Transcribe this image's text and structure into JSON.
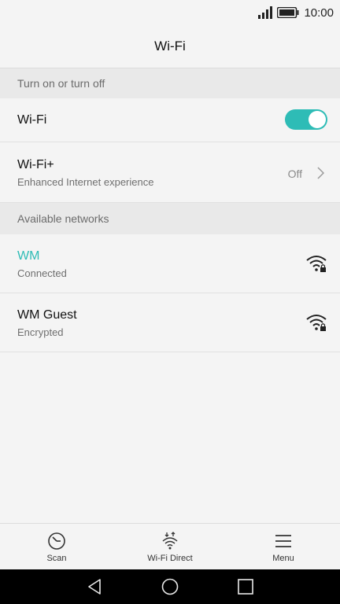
{
  "status_bar": {
    "time": "10:00"
  },
  "header": {
    "title": "Wi-Fi"
  },
  "sections": {
    "toggle_section": "Turn on or turn off",
    "networks_section": "Available networks"
  },
  "wifi_toggle": {
    "label": "Wi-Fi",
    "state": "on"
  },
  "wifi_plus": {
    "label": "Wi-Fi+",
    "subtitle": "Enhanced Internet experience",
    "value": "Off"
  },
  "networks": [
    {
      "name": "WM",
      "status": "Connected",
      "name_color": "#2ebcb6"
    },
    {
      "name": "WM Guest",
      "status": "Encrypted",
      "name_color": "#111111"
    }
  ],
  "toolbar": {
    "scan": "Scan",
    "wifi_direct": "Wi-Fi Direct",
    "menu": "Menu"
  },
  "colors": {
    "accent": "#2ebcb6",
    "background": "#f4f4f4",
    "section_bg": "#e9e9e9"
  },
  "icons": [
    "signal-icon",
    "battery-icon",
    "wifi-lock-icon",
    "chevron-right-icon",
    "scan-icon",
    "wifi-direct-icon",
    "menu-icon",
    "back-icon",
    "home-icon",
    "recents-icon"
  ]
}
